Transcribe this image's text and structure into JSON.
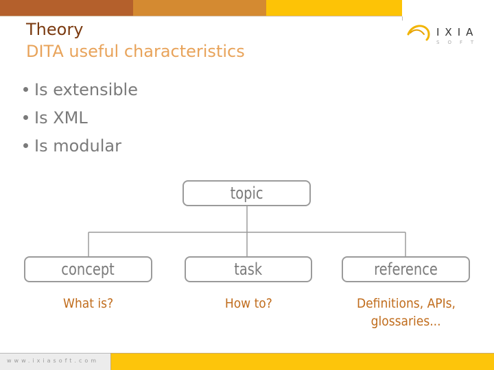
{
  "header": {
    "colors": [
      "#b4602c",
      "#d48a31",
      "#fdc306"
    ]
  },
  "logo": {
    "name": "IXIA",
    "sub": "SOFT"
  },
  "title": {
    "line1": "Theory",
    "line2": "DITA useful characteristics"
  },
  "bullets": [
    "Is extensible",
    "Is XML",
    "Is modular"
  ],
  "diagram": {
    "root": "topic",
    "children": [
      {
        "label": "concept",
        "caption": "What is?"
      },
      {
        "label": "task",
        "caption": "How to?"
      },
      {
        "label": "reference",
        "caption_line1": "Definitions, APIs,",
        "caption_line2": "glossaries..."
      }
    ]
  },
  "footer": {
    "url": "www.ixiasoft.com"
  }
}
